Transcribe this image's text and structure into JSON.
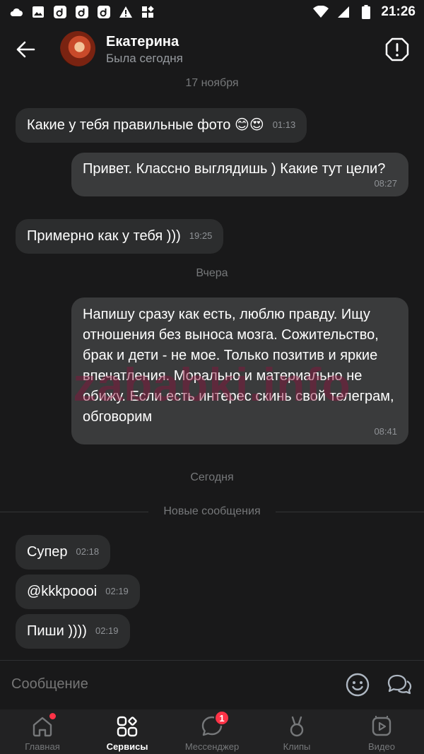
{
  "status_bar": {
    "time": "21:26"
  },
  "header": {
    "contact_name": "Екатерина",
    "contact_status": "Была сегодня"
  },
  "date_separators": [
    "17 ноября",
    "Вчера",
    "Сегодня"
  ],
  "new_messages_label": "Новые сообщения",
  "messages": [
    {
      "direction": "incoming",
      "text": "Какие у тебя правильные фото 😊😍",
      "time": "01:13"
    },
    {
      "direction": "outgoing",
      "text": "Привет. Классно выглядишь ) Какие тут цели?",
      "time": "08:27"
    },
    {
      "direction": "incoming",
      "text": "Примерно как у тебя )))",
      "time": "19:25"
    },
    {
      "direction": "outgoing",
      "text": "Напишу сразу как есть, люблю правду. Ищу отношения без выноса мозга. Сожительство, брак и дети - не мое. Только позитив и яркие впечатления. Морально и материально не обижу. Если есть интерес скинь свой телеграм, обговорим",
      "time": "08:41"
    },
    {
      "direction": "incoming",
      "text": "Супер",
      "time": "02:18"
    },
    {
      "direction": "incoming",
      "text": "@kkkpoooi",
      "time": "02:19"
    },
    {
      "direction": "incoming",
      "text": "Пиши ))))",
      "time": "02:19"
    }
  ],
  "composer": {
    "placeholder": "Сообщение"
  },
  "tabbar": {
    "tabs": [
      {
        "label": "Главная",
        "icon": "home-icon"
      },
      {
        "label": "Сервисы",
        "icon": "services-icon",
        "active": true
      },
      {
        "label": "Мессенджер",
        "icon": "messenger-icon",
        "badge": "1"
      },
      {
        "label": "Клипы",
        "icon": "clips-icon"
      },
      {
        "label": "Видео",
        "icon": "video-icon"
      }
    ]
  },
  "watermark": "zababki.info",
  "colors": {
    "background": "#19191a",
    "bubble": "#2c2d2e",
    "accent_red": "#ff3347"
  }
}
